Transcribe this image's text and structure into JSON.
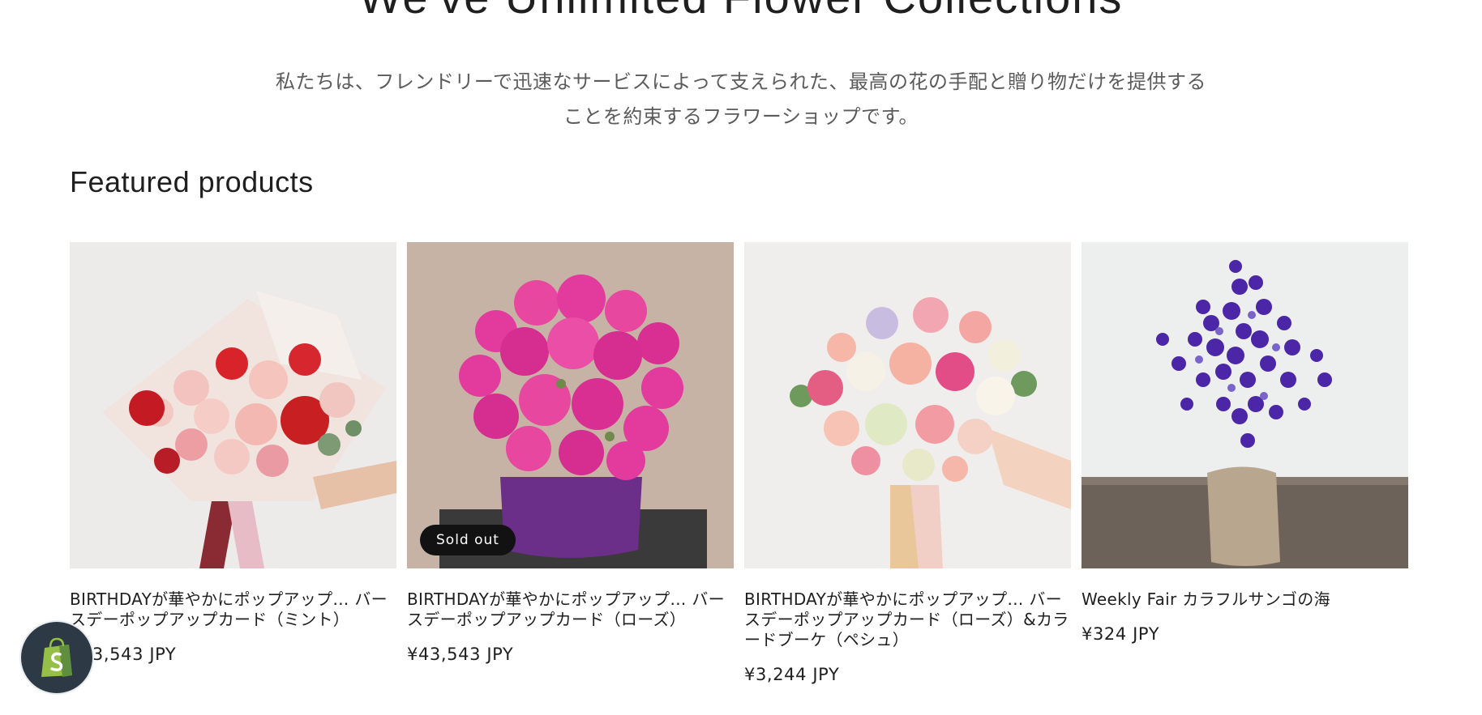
{
  "hero": {
    "title": "We've Unlimited Flower Collections",
    "description": "私たちは、フレンドリーで迅速なサービスによって支えられた、最高の花の手配と贈り物だけを提供することを約束するフラワーショップです。"
  },
  "featured": {
    "title": "Featured products",
    "products": [
      {
        "name": "BIRTHDAYが華やかにポップアップ… バースデーポップアップカード（ミント）",
        "price": "¥43,543 JPY",
        "badge": ""
      },
      {
        "name": "BIRTHDAYが華やかにポップアップ… バースデーポップアップカード（ローズ）",
        "price": "¥43,543 JPY",
        "badge": "Sold out"
      },
      {
        "name": "BIRTHDAYが華やかにポップアップ… バースデーポップアップカード（ローズ）&カラードブーケ（ペシュ）",
        "price": "¥3,244 JPY",
        "badge": ""
      },
      {
        "name": "Weekly Fair カラフルサンゴの海",
        "price": "¥324 JPY",
        "badge": ""
      }
    ]
  },
  "icons": {
    "shopify": "shopify-bag-icon"
  },
  "colors": {
    "badge_bg": "#121212",
    "shopify_bg": "#2d3a45"
  }
}
